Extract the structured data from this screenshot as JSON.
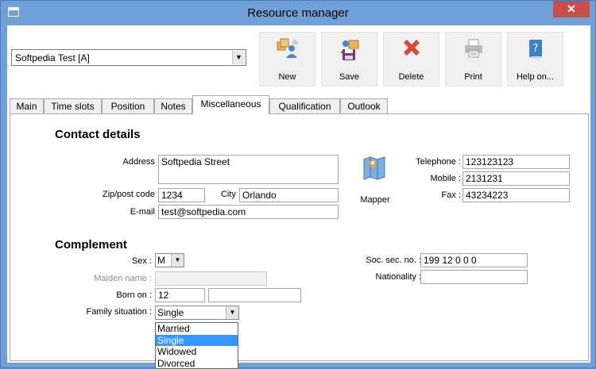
{
  "window": {
    "title": "Resource manager",
    "close_glyph": "✕"
  },
  "resource_select": {
    "value": "Softpedia Test [A]"
  },
  "toolbar": [
    {
      "label": "New",
      "icon": "new-resource-icon"
    },
    {
      "label": "Save",
      "icon": "save-icon"
    },
    {
      "label": "Delete",
      "icon": "delete-icon"
    },
    {
      "label": "Print",
      "icon": "printer-icon"
    },
    {
      "label": "Help on...",
      "icon": "help-book-icon"
    }
  ],
  "tabs": [
    {
      "label": "Main"
    },
    {
      "label": "Time slots"
    },
    {
      "label": "Position"
    },
    {
      "label": "Notes"
    },
    {
      "label": "Miscellaneous",
      "active": true
    },
    {
      "label": "Qualification"
    },
    {
      "label": "Outlook"
    }
  ],
  "contact": {
    "heading": "Contact details",
    "address_label": "Address :",
    "address": "Softpedia Street",
    "zip_label": "Zip/post code :",
    "zip": "1234",
    "city_label": "City :",
    "city": "Orlando",
    "email_label": "E-mail :",
    "email": "test@softpedia.com",
    "mapper_label": "Mapper",
    "telephone_label": "Telephone :",
    "telephone": "123123123",
    "mobile_label": "Mobile :",
    "mobile": "2131231",
    "fax_label": "Fax :",
    "fax": "43234223"
  },
  "complement": {
    "heading": "Complement",
    "sex_label": "Sex :",
    "sex": "M",
    "maiden_label": "Maiden name :",
    "maiden": "",
    "born_label": "Born on :",
    "born_day": "12",
    "born_rest": "",
    "family_label": "Family situation :",
    "family": "Single",
    "family_options": [
      "Married",
      "Single",
      "Widowed",
      "Divorced"
    ],
    "family_selected": 1,
    "ssn_label": "Soc. sec. no. :",
    "ssn": "199 12 0 0 0",
    "nationality_label": "Nationality :",
    "nationality": ""
  }
}
